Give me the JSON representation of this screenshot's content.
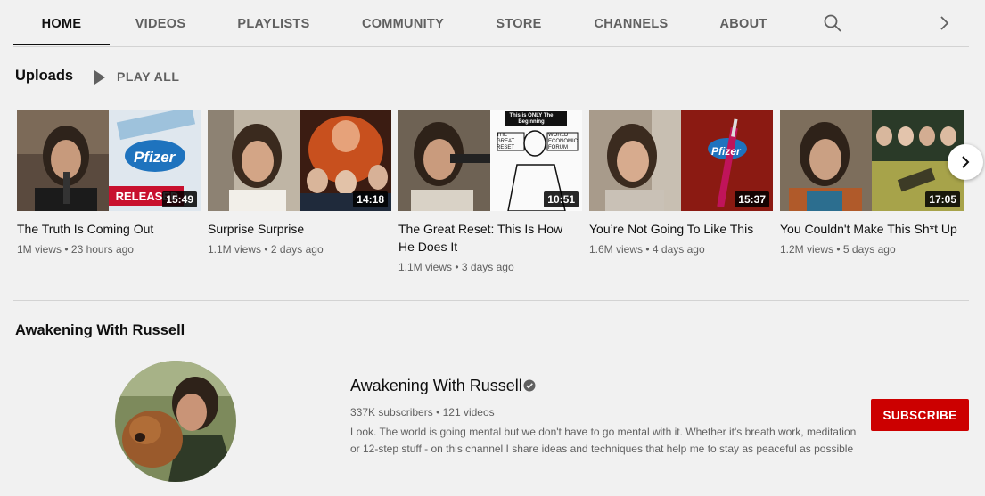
{
  "tabs": [
    {
      "label": "HOME",
      "active": true
    },
    {
      "label": "VIDEOS"
    },
    {
      "label": "PLAYLISTS"
    },
    {
      "label": "COMMUNITY"
    },
    {
      "label": "STORE"
    },
    {
      "label": "CHANNELS"
    },
    {
      "label": "ABOUT"
    }
  ],
  "tab_icons": [
    "search-icon",
    "chevron-right-icon"
  ],
  "uploads": {
    "title": "Uploads",
    "play_all_label": "PLAY ALL",
    "videos": [
      {
        "title": "The Truth Is Coming Out",
        "views": "1M views",
        "age": "23 hours ago",
        "duration": "15:49"
      },
      {
        "title": "Surprise Surprise",
        "views": "1.1M views",
        "age": "2 days ago",
        "duration": "14:18"
      },
      {
        "title": "The Great Reset: This Is How He Does It",
        "views": "1.1M views",
        "age": "3 days ago",
        "duration": "10:51"
      },
      {
        "title": "You’re Not Going To Like This",
        "views": "1.6M views",
        "age": "4 days ago",
        "duration": "15:37"
      },
      {
        "title": "You Couldn't Make This Sh*t Up",
        "views": "1.2M views",
        "age": "5 days ago",
        "duration": "17:05"
      }
    ],
    "thumb_text": {
      "v1": {
        "logo": "Pfizer",
        "banner": "RELEASED"
      },
      "v3": {
        "caption": "This is ONLY The Beginning",
        "left_sign": "THE GREAT RESET",
        "right_sign": "WORLD ECONOMIC FORUM"
      },
      "v4": {
        "logo": "Pfizer"
      }
    },
    "meta_separator": "•"
  },
  "channel": {
    "section_title": "Awakening With Russell",
    "name": "Awakening With Russell",
    "subscribers": "337K subscribers",
    "videos": "121 videos",
    "description": "Look. The world is going mental but we don't have to go mental with it. Whether it's breath work, meditation or 12-step stuff - on this channel I share ideas and techniques that help me to stay as peaceful as possible",
    "subscribe_label": "SUBSCRIBE"
  },
  "colors": {
    "background": "#f1f1f1",
    "subscribe": "#cc0000",
    "secondary_text": "#606060"
  }
}
